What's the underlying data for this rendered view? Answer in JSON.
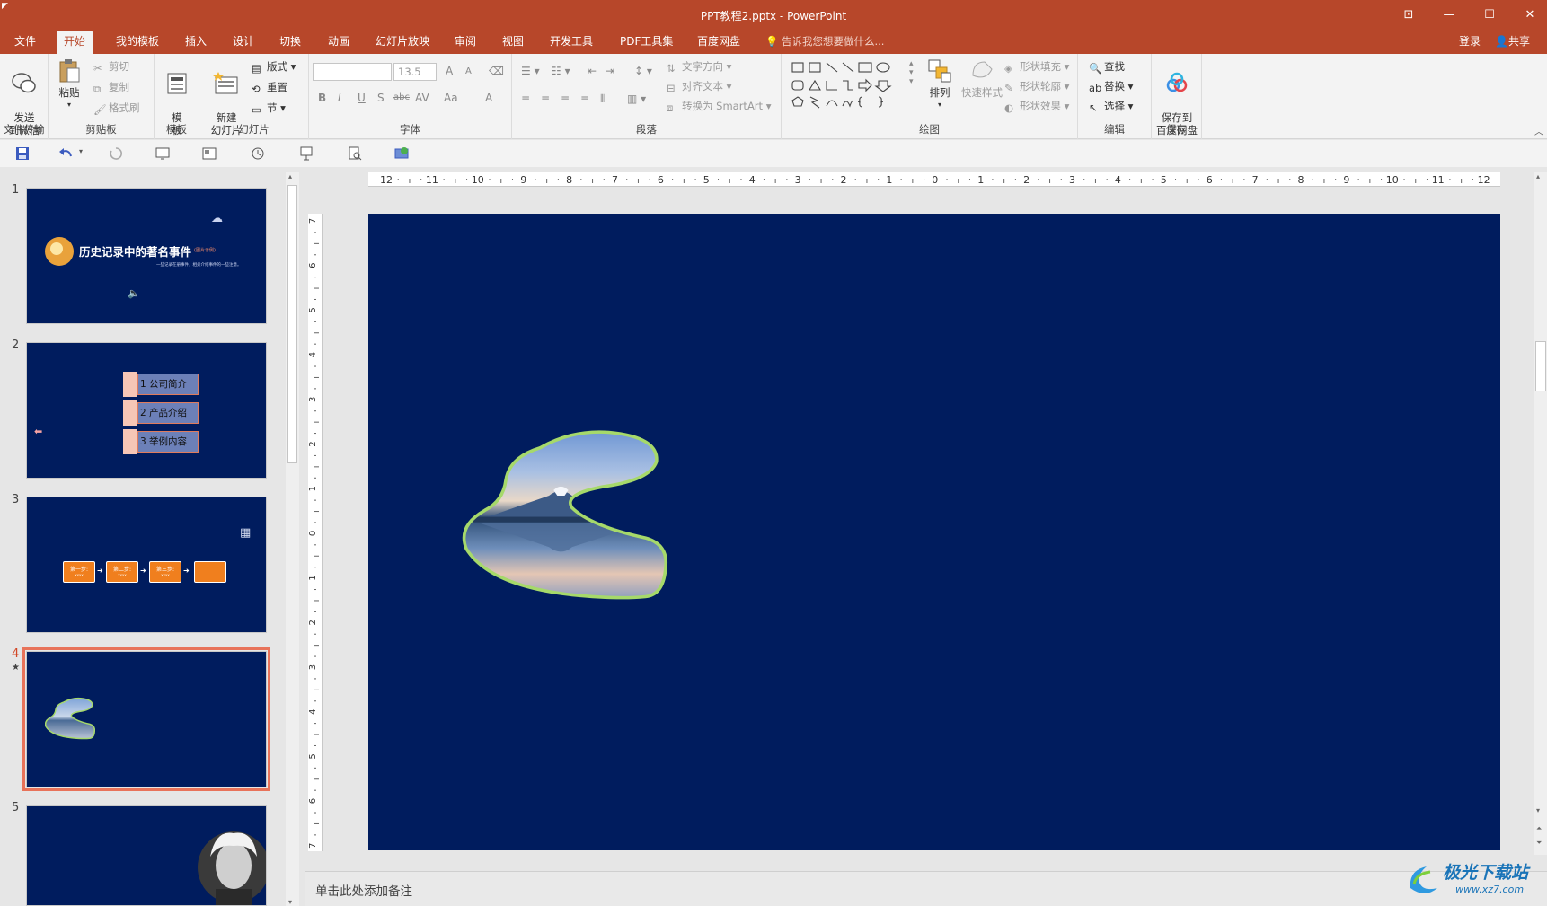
{
  "window": {
    "title": "PPT教程2.pptx - PowerPoint",
    "controls": [
      "⊡",
      "—",
      "☐",
      "✕"
    ]
  },
  "tabs": [
    "文件",
    "开始",
    "我的模板",
    "插入",
    "设计",
    "切换",
    "动画",
    "幻灯片放映",
    "审阅",
    "视图",
    "开发工具",
    "PDF工具集",
    "百度网盘"
  ],
  "active_tab": "开始",
  "tell_me": "告诉我您想要做什么...",
  "account": {
    "login": "登录",
    "share": "共享"
  },
  "ribbon": {
    "file_transfer": {
      "button": "发送\n到微信",
      "label": "文件传输"
    },
    "clipboard": {
      "paste": "粘贴",
      "cut": "剪切",
      "copy": "复制",
      "format_painter": "格式刷",
      "label": "剪贴板"
    },
    "template": {
      "button": "模\n板",
      "label": "模板"
    },
    "slides": {
      "new_slide": "新建\n幻灯片",
      "layout": "版式",
      "reset": "重置",
      "section": "节",
      "label": "幻灯片"
    },
    "font": {
      "size": "13.5",
      "bold": "B",
      "italic": "I",
      "underline": "U",
      "shadow": "S",
      "strike": "abc",
      "spacing": "AV",
      "case": "Aa",
      "color": "A",
      "grow": "A",
      "shrink": "A",
      "label": "字体"
    },
    "paragraph": {
      "text_direction": "文字方向",
      "align_text": "对齐文本",
      "smartart": "转换为 SmartArt",
      "label": "段落"
    },
    "drawing": {
      "arrange": "排列",
      "quick_styles": "快速样式",
      "shape_fill": "形状填充",
      "shape_outline": "形状轮廓",
      "shape_effects": "形状效果",
      "label": "绘图"
    },
    "editing": {
      "find": "查找",
      "replace": "替换",
      "select": "选择",
      "label": "编辑"
    },
    "save": {
      "button": "保存到\n百度网盘",
      "label": "保存"
    }
  },
  "slides_panel": {
    "slides": [
      {
        "number": "1",
        "title": "历史记录中的著名事件",
        "tag": "(图片示例)",
        "subtitle": "一些记录在册事件，相关介绍事件的一些注意。"
      },
      {
        "number": "2",
        "items": [
          "1 公司简介",
          "2 产品介绍",
          "3 举例内容"
        ]
      },
      {
        "number": "3",
        "steps": [
          "第一步:",
          "第二步:",
          "第三步:",
          ""
        ],
        "step_sub": "xxxx"
      },
      {
        "number": "4",
        "star": "★"
      },
      {
        "number": "5"
      }
    ],
    "selected": "4"
  },
  "ruler": {
    "horizontal": [
      "12",
      "11",
      "10",
      "9",
      "8",
      "7",
      "6",
      "5",
      "4",
      "3",
      "2",
      "1",
      "0",
      "1",
      "2",
      "3",
      "4",
      "5",
      "6",
      "7",
      "8",
      "9",
      "10",
      "11",
      "12"
    ],
    "vertical": [
      "7",
      "6",
      "5",
      "4",
      "3",
      "2",
      "1",
      "0",
      "1",
      "2",
      "3",
      "4",
      "5",
      "6",
      "7"
    ]
  },
  "notes_placeholder": "单击此处添加备注",
  "watermark": {
    "main": "极光下载站",
    "sub": "www.xz7.com"
  },
  "colors": {
    "accent": "#b7472a",
    "slide_bg": "#001c5e",
    "selection": "#e8735a",
    "shape_outline": "#a6d96a"
  }
}
